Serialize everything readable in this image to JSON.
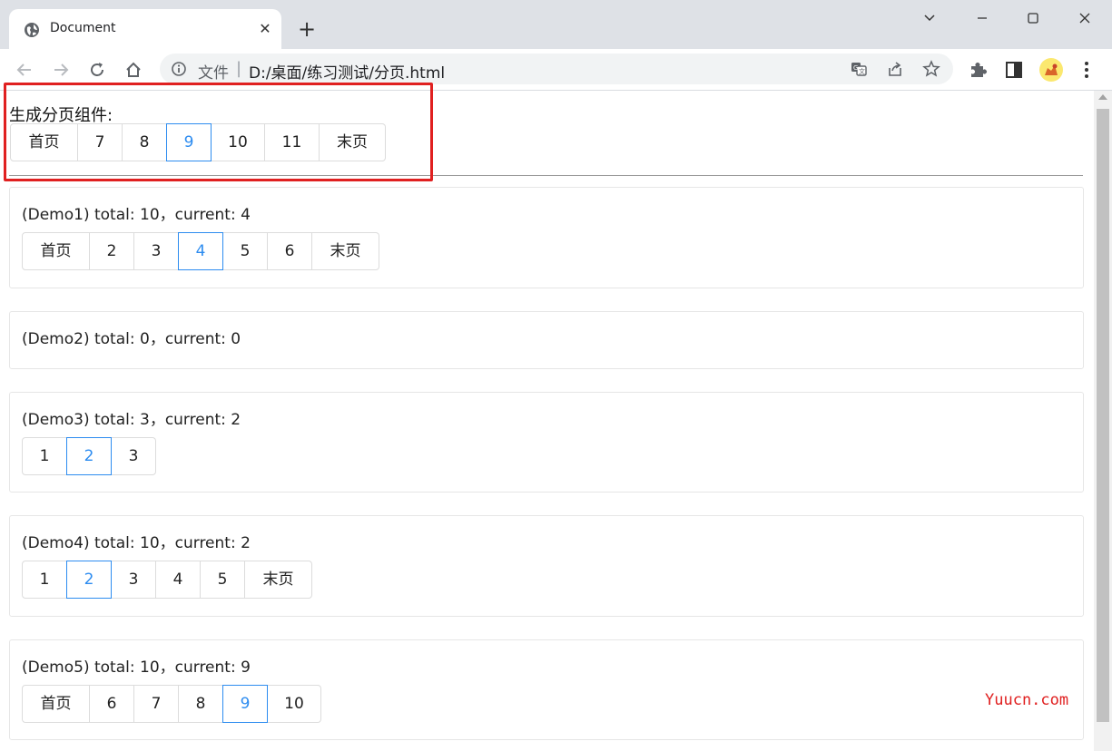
{
  "browser": {
    "tab_title": "Document",
    "new_tab_symbol": "+",
    "close_symbol": "✕",
    "address": {
      "scheme_label": "文件",
      "separator": "|",
      "url": "D:/桌面/练习测试/分页.html"
    }
  },
  "page": {
    "heading": "生成分页组件:",
    "main_pager": [
      "首页",
      "7",
      "8",
      "9",
      "10",
      "11",
      "末页"
    ],
    "demos": [
      {
        "label": "(Demo1) total: 10，current: 4",
        "items": [
          "首页",
          "2",
          "3",
          "4",
          "5",
          "6",
          "末页"
        ]
      },
      {
        "label": "(Demo2) total: 0，current: 0",
        "items": []
      },
      {
        "label": "(Demo3) total: 3，current: 2",
        "items": [
          "1",
          "2",
          "3"
        ]
      },
      {
        "label": "(Demo4) total: 10，current: 2",
        "items": [
          "1",
          "2",
          "3",
          "4",
          "5",
          "末页"
        ]
      },
      {
        "label": "(Demo5) total: 10，current: 9",
        "items": [
          "首页",
          "6",
          "7",
          "8",
          "9",
          "10"
        ]
      }
    ]
  },
  "watermark": "Yuucn.com",
  "colors": {
    "active": "#2d8cf0",
    "highlight": "#e02020"
  }
}
